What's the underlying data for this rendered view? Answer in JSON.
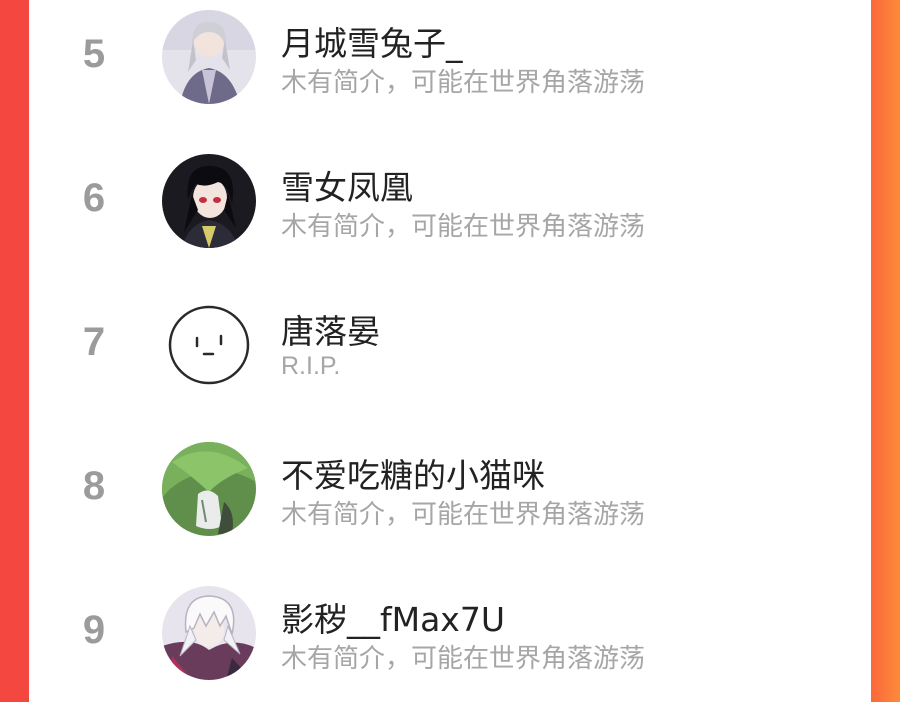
{
  "colors": {
    "background_left": "#f4473f",
    "background_right": "#fd8a3b",
    "rank_text": "#9b9b9b",
    "name_text": "#222222",
    "bio_text": "#a6a6a6"
  },
  "rankings": [
    {
      "rank": "5",
      "name": "月城雪兔子_",
      "bio": "木有简介，可能在世界角落游荡",
      "avatar": "anime-boy-grey-hair-avatar"
    },
    {
      "rank": "6",
      "name": "雪女凤凰",
      "bio": "木有简介，可能在世界角落游荡",
      "avatar": "anime-boy-black-hair-avatar"
    },
    {
      "rank": "7",
      "name": "唐落晏",
      "bio": "R.I.P.",
      "avatar": "doodle-face-avatar"
    },
    {
      "rank": "8",
      "name": "不爱吃糖的小猫咪",
      "bio": "木有简介，可能在世界角落游荡",
      "avatar": "green-leaf-avatar"
    },
    {
      "rank": "9",
      "name": "影秽__fMax7U",
      "bio": "木有简介，可能在世界角落游荡",
      "avatar": "anime-white-hair-avatar"
    }
  ]
}
